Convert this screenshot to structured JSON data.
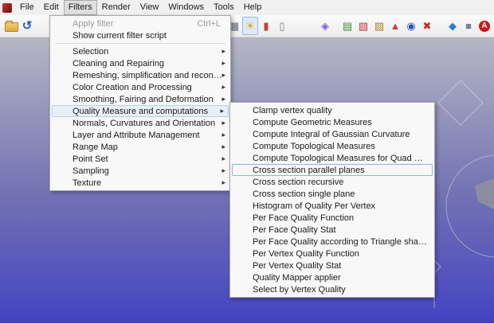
{
  "colors": {
    "viewport_top": "#b6b6c4",
    "viewport_mid": "#7272b4",
    "viewport_bottom": "#4343c2",
    "menu_highlight_bg": "#e9eff9",
    "menu_highlight_border": "#b5d0ee",
    "focus_outline": "#8fb4e0",
    "toolbar_pressed_bg": "#dfeaf7",
    "toolbar_pressed_border": "#9ab8dd",
    "badge_red": "#c81818"
  },
  "icons": {
    "submenu_arrow": "▸"
  },
  "menu_bar": {
    "items": [
      "File",
      "Edit",
      "Filters",
      "Render",
      "View",
      "Windows",
      "Tools",
      "Help"
    ],
    "active_item": "Filters"
  },
  "toolbar": {
    "left_icons": [
      {
        "name": "open-file-icon"
      },
      {
        "name": "reload-icon",
        "glyph": "↺",
        "color": "#2060c0"
      }
    ],
    "mid_icons": [
      {
        "name": "render-mode-icon",
        "glyph": "▦",
        "color": "#606878"
      },
      {
        "name": "light-toggle-icon",
        "glyph": "☀",
        "color": "#e0a800",
        "pressed": true
      },
      {
        "name": "decorator-red-icon",
        "glyph": "▮",
        "color": "#c04040"
      },
      {
        "name": "decorator-gray-icon",
        "glyph": "▯",
        "color": "#707888"
      }
    ],
    "right_icons": [
      {
        "name": "manipulator-icon",
        "glyph": "◈",
        "color": "#7a5ad0"
      },
      {
        "name": "layers-icon",
        "glyph": "▤",
        "color": "#3a8a3a"
      },
      {
        "name": "color-paint-icon",
        "glyph": "▧",
        "color": "#c03838"
      },
      {
        "name": "measure-icon",
        "glyph": "▨",
        "color": "#b08030"
      },
      {
        "name": "select-face-icon",
        "glyph": "▲",
        "color": "#c84040"
      },
      {
        "name": "select-vertex-icon",
        "glyph": "◉",
        "color": "#3050b8"
      },
      {
        "name": "delete-face-icon",
        "glyph": "✖",
        "color": "#c02828"
      },
      {
        "name": "align-icon",
        "glyph": "◆",
        "color": "#2e7dd0"
      },
      {
        "name": "matrix-icon",
        "glyph": "■",
        "color": "#7a8294"
      },
      {
        "name": "annotation-icon",
        "glyph": "A",
        "color": "#ffffff"
      },
      {
        "name": "star-quality-icon",
        "glyph": "★",
        "color": "#d8a020"
      },
      {
        "name": "extra-tool-icon",
        "glyph": "◇",
        "color": "#8890a0"
      }
    ]
  },
  "filters_menu": {
    "items": [
      {
        "label": "Apply filter",
        "shortcut": "Ctrl+L",
        "state": "disabled"
      },
      {
        "label": "Show current filter script"
      },
      {
        "label": "Selection",
        "has_submenu": true
      },
      {
        "label": "Cleaning and Repairing",
        "has_submenu": true
      },
      {
        "label": "Remeshing, simplification and reconstruction",
        "has_submenu": true
      },
      {
        "label": "Color Creation and Processing",
        "has_submenu": true
      },
      {
        "label": "Smoothing, Fairing and Deformation",
        "has_submenu": true
      },
      {
        "label": "Quality Measure and computations",
        "has_submenu": true,
        "state": "highlighted"
      },
      {
        "label": "Normals, Curvatures and Orientation",
        "has_submenu": true
      },
      {
        "label": "Layer and Attribute Management",
        "has_submenu": true
      },
      {
        "label": "Range Map",
        "has_submenu": true
      },
      {
        "label": "Point Set",
        "has_submenu": true
      },
      {
        "label": "Sampling",
        "has_submenu": true
      },
      {
        "label": "Texture",
        "has_submenu": true
      }
    ]
  },
  "quality_submenu": {
    "items": [
      {
        "label": "Clamp vertex quality"
      },
      {
        "label": "Compute Geometric Measures"
      },
      {
        "label": "Compute Integral of Gaussian Curvature"
      },
      {
        "label": "Compute Topological Measures"
      },
      {
        "label": "Compute Topological Measures for Quad Meshes"
      },
      {
        "label": "Cross section parallel planes",
        "state": "focused"
      },
      {
        "label": "Cross section recursive"
      },
      {
        "label": "Cross section single plane"
      },
      {
        "label": "Histogram of Quality Per Vertex"
      },
      {
        "label": "Per Face Quality Function"
      },
      {
        "label": "Per Face Quality Stat"
      },
      {
        "label": "Per Face Quality according to Triangle shape and aspect ratio"
      },
      {
        "label": "Per Vertex Quality Function"
      },
      {
        "label": "Per Vertex Quality Stat"
      },
      {
        "label": "Quality Mapper applier"
      },
      {
        "label": "Select by Vertex Quality"
      }
    ]
  },
  "viewport": {
    "scene_shapes": [
      "diamond-outline",
      "circle-arc",
      "gray-plane",
      "axis-line",
      "small-diamond-outline"
    ]
  }
}
